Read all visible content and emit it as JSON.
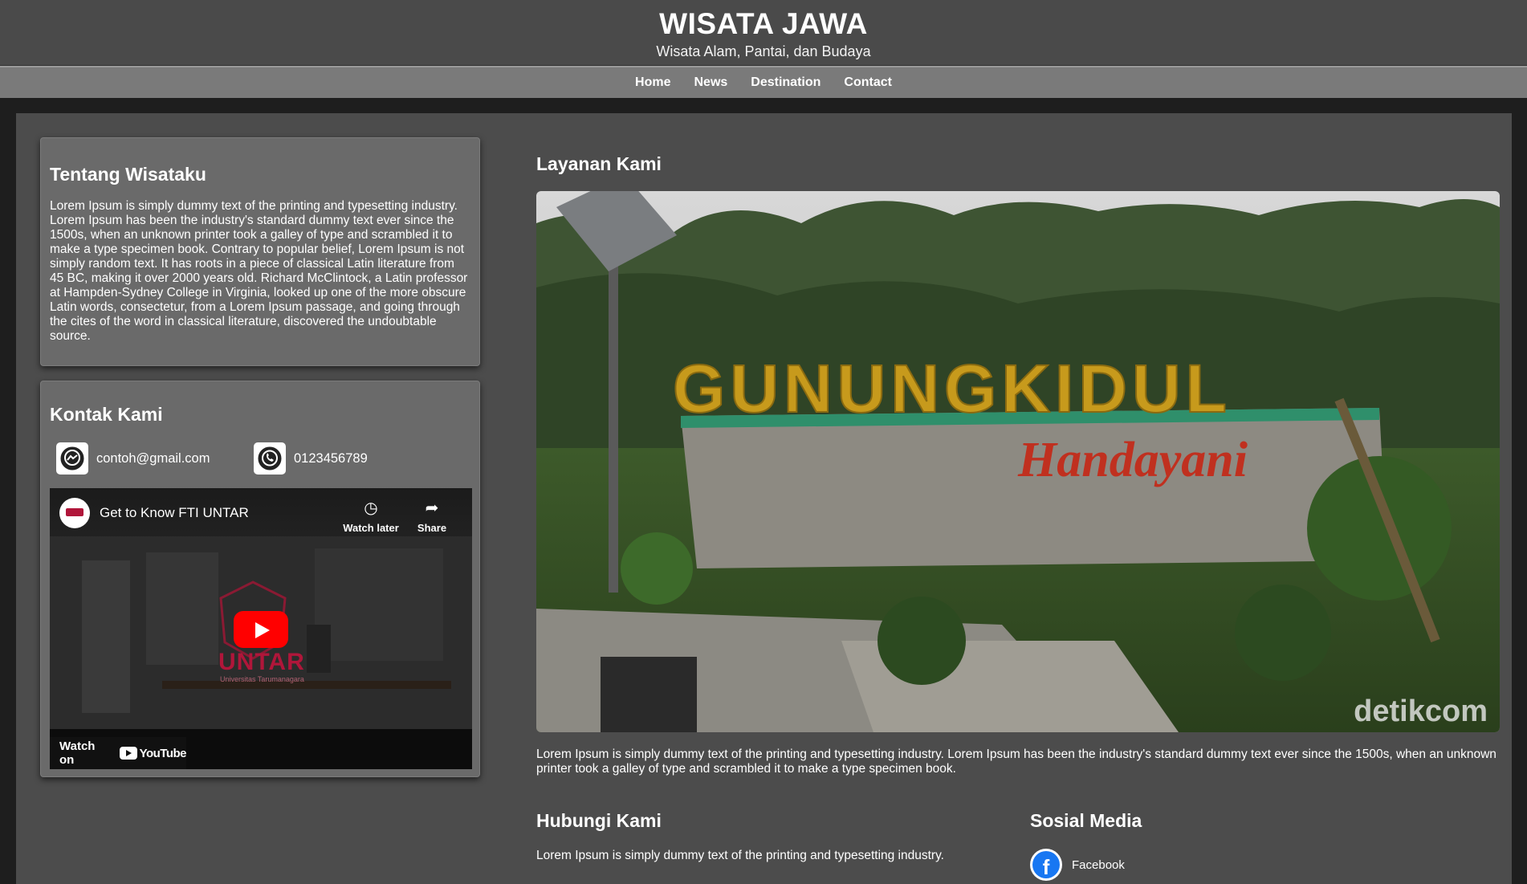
{
  "header": {
    "title": "WISATA JAWA",
    "subtitle": "Wisata Alam, Pantai, dan Budaya"
  },
  "nav": {
    "items": [
      "Home",
      "News",
      "Destination",
      "Contact"
    ]
  },
  "about": {
    "heading": "Tentang Wisataku",
    "body": "Lorem Ipsum is simply dummy text of the printing and typesetting industry. Lorem Ipsum has been the industry's standard dummy text ever since the 1500s, when an unknown printer took a galley of type and scrambled it to make a type specimen book. Contrary to popular belief, Lorem Ipsum is not simply random text. It has roots in a piece of classical Latin literature from 45 BC, making it over 2000 years old. Richard McClintock, a Latin professor at Hampden-Sydney College in Virginia, looked up one of the more obscure Latin words, consectetur, from a Lorem Ipsum passage, and going through the cites of the word in classical literature, discovered the undoubtable source."
  },
  "contact": {
    "heading": "Kontak Kami",
    "email": "contoh@gmail.com",
    "phone": "0123456789",
    "email_icon": "messenger-icon",
    "phone_icon": "whatsapp-icon"
  },
  "video": {
    "title": "Get to Know FTI UNTAR",
    "watch_later": "Watch later",
    "share": "Share",
    "watch_on": "Watch on",
    "platform": "YouTube",
    "brand": "UNTAR",
    "brand_sub": "Universitas Tarumanagara",
    "brand_color": "#b0163a"
  },
  "services": {
    "heading": "Layanan Kami",
    "image_sign": "GUNUNGKIDUL",
    "image_script": "Handayani",
    "image_watermark": "detikcom",
    "body": "Lorem Ipsum is simply dummy text of the printing and typesetting industry. Lorem Ipsum has been the industry's standard dummy text ever since the 1500s, when an unknown printer took a galley of type and scrambled it to make a type specimen book."
  },
  "hubungi": {
    "heading": "Hubungi Kami",
    "body": "Lorem Ipsum is simply dummy text of the printing and typesetting industry."
  },
  "social": {
    "heading": "Sosial Media",
    "facebook_label": "Facebook",
    "facebook_icon": "facebook-icon",
    "facebook_color": "#1877f2"
  },
  "colors": {
    "header_bg": "#4a4a4a",
    "nav_bg": "#7a7a7a",
    "page_bg": "#1e1e1e",
    "content_bg": "#4c4c4c",
    "card_bg": "#6a6a6a"
  }
}
